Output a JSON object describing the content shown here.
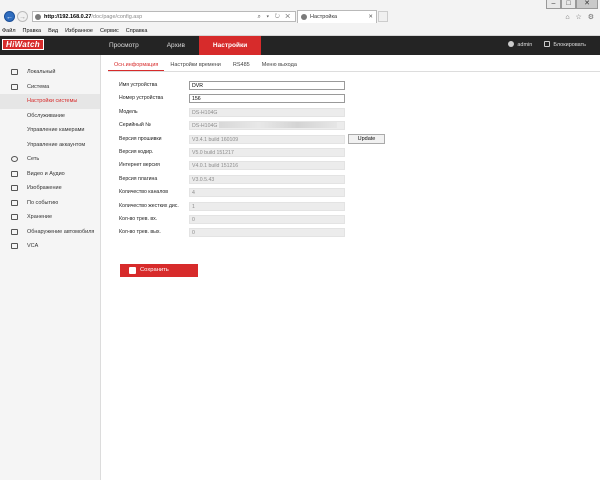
{
  "browser": {
    "address_host": "http://192.168.0.27",
    "address_path": "/doc/page/config.asp",
    "address_tools": "⌕ ▾ ↻ ✕",
    "tab_title": "Настройка",
    "tab_close": "✕",
    "window_controls": [
      "–",
      "□",
      "✕"
    ],
    "right_tools": "⌂ ☆ ⚙",
    "nav_back": "←",
    "nav_forward": "→",
    "menu": [
      "Файл",
      "Правка",
      "Вид",
      "Избранное",
      "Сервис",
      "Справка"
    ]
  },
  "header": {
    "logo": "HiWatch",
    "nav": [
      {
        "label": "Просмотр",
        "active": false
      },
      {
        "label": "Архив",
        "active": false
      },
      {
        "label": "Настройки",
        "active": true
      }
    ],
    "user": "admin",
    "logout": "Блокировать"
  },
  "sidebar": {
    "items": [
      {
        "label": "Локальный",
        "icon": "monitor-icon"
      },
      {
        "label": "Система",
        "icon": "system-icon"
      }
    ],
    "system_sub": [
      {
        "label": "Настройки системы",
        "active": true
      },
      {
        "label": "Обслуживание",
        "active": false
      },
      {
        "label": "Управление камерами",
        "active": false
      },
      {
        "label": "Управление аккаунтом",
        "active": false
      }
    ],
    "items2": [
      {
        "label": "Сеть",
        "icon": "network-icon"
      },
      {
        "label": "Видео и Аудио",
        "icon": "video-audio-icon"
      },
      {
        "label": "Изображение",
        "icon": "image-icon"
      },
      {
        "label": "По событию",
        "icon": "event-icon"
      },
      {
        "label": "Хранение",
        "icon": "storage-icon"
      },
      {
        "label": "Обнаружение автомобиля",
        "icon": "vehicle-detection-icon"
      },
      {
        "label": "VCA",
        "icon": "vca-icon"
      }
    ]
  },
  "subtabs": [
    {
      "label": "Осн.информация",
      "active": true
    },
    {
      "label": "Настройки времени",
      "active": false
    },
    {
      "label": "RS485",
      "active": false
    },
    {
      "label": "Меню выхода",
      "active": false
    }
  ],
  "form": {
    "device_name": {
      "label": "Имя устройства",
      "value": "DVR"
    },
    "device_number": {
      "label": "Номер устройства",
      "value": "156"
    },
    "model": {
      "label": "Модель",
      "value": "DS-H104G"
    },
    "serial": {
      "label": "Серийный №",
      "value": "DS-H104G"
    },
    "firmware": {
      "label": "Версия прошивки",
      "value": "V3.4.1 build 160109"
    },
    "encoder": {
      "label": "Версия кодир.",
      "value": "V5.0 build 151217"
    },
    "web": {
      "label": "Интернет версия",
      "value": "V4.0.1 build 151216"
    },
    "plugin": {
      "label": "Версия плагина",
      "value": "V3.0.5.43"
    },
    "channels": {
      "label": "Количество каналов",
      "value": "4"
    },
    "hdd": {
      "label": "Количество жестких дис.",
      "value": "1"
    },
    "alarm_in": {
      "label": "Кол-во трев. вх.",
      "value": "0"
    },
    "alarm_out": {
      "label": "Кол-во трев. вых.",
      "value": "0"
    },
    "update_label": "Update"
  },
  "save_label": "Сохранить",
  "colors": {
    "accent": "#d72b2b",
    "header_bg": "#242424"
  }
}
